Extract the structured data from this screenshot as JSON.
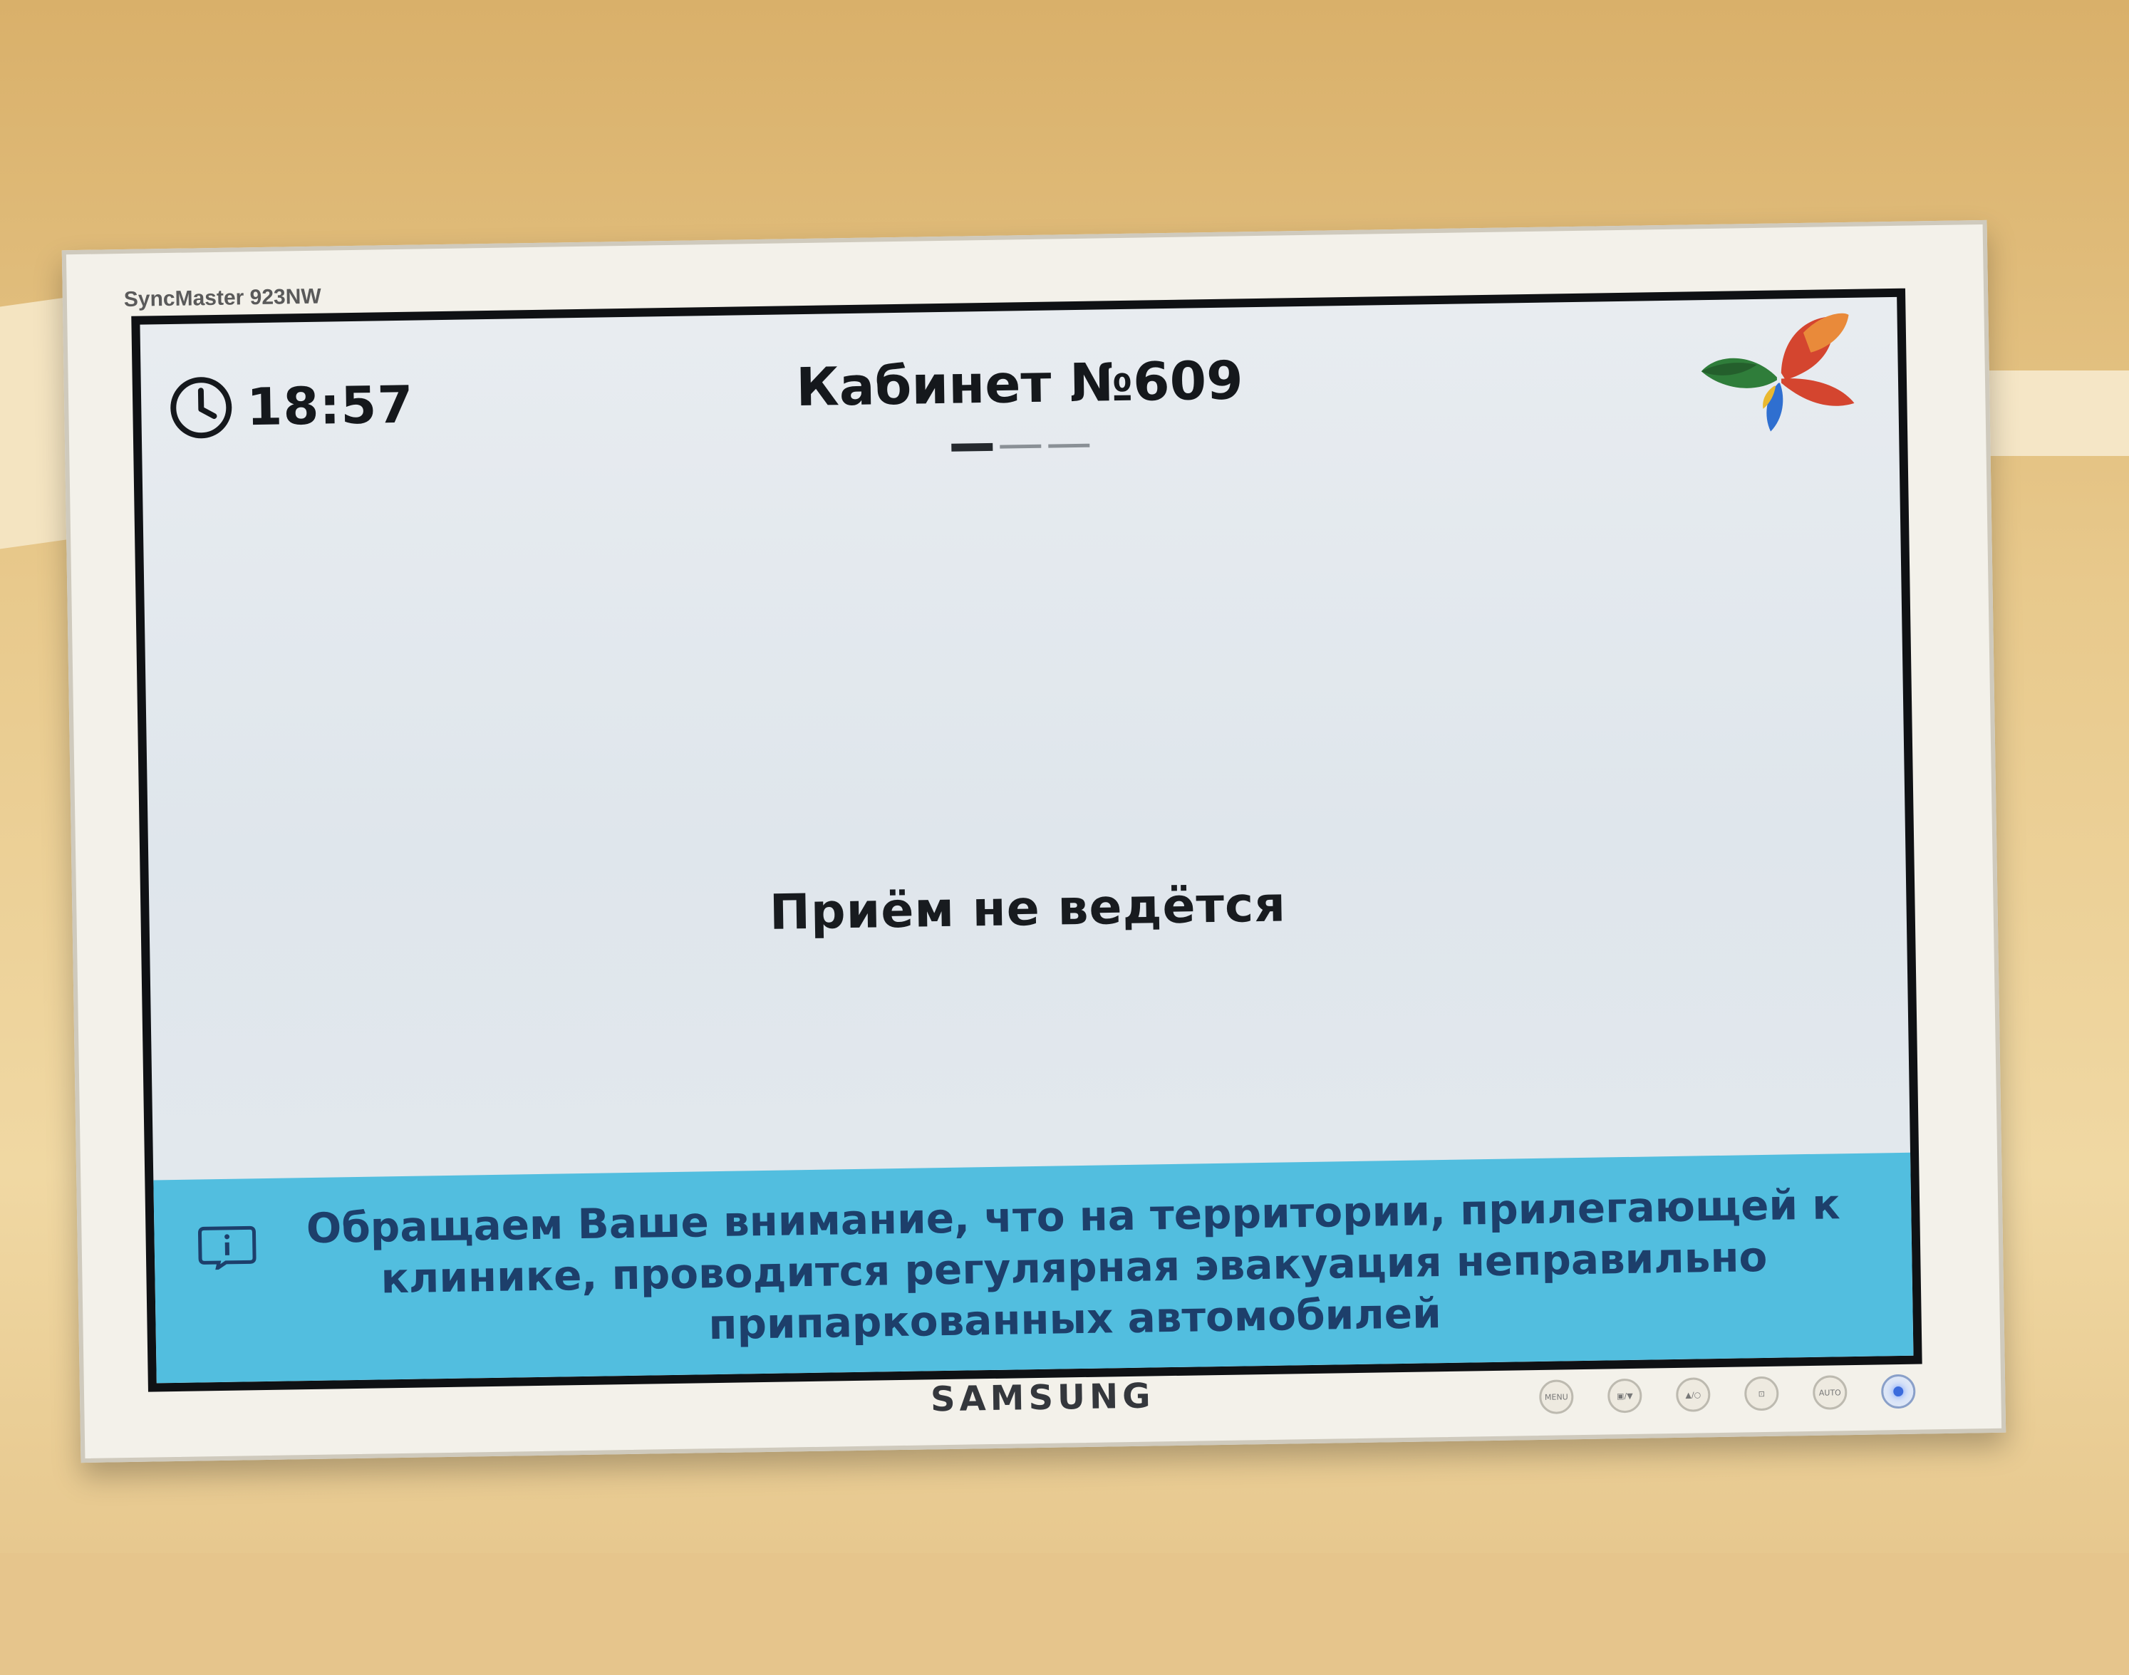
{
  "monitor": {
    "model_label": "SyncMaster 923NW",
    "brand": "SAMSUNG",
    "buttons": [
      "MENU",
      "▣/▼",
      "▲/○",
      "⊡",
      "AUTO",
      ""
    ]
  },
  "header": {
    "time": "18:57",
    "room_title": "Кабинет №609",
    "pager": {
      "pages": 3,
      "active_index": 0
    }
  },
  "main": {
    "status_text": "Приём не ведётся"
  },
  "notice": {
    "text": "Обращаем Ваше внимание, что на территории, прилегающей к клинике, проводится регулярная эвакуация неправильно припаркованных автомобилей",
    "icon": "info-icon"
  },
  "colors": {
    "screen_background": "#e4e9ee",
    "notice_background": "#52bedf",
    "notice_text": "#1d3f6b",
    "logo_red": "#d4452f",
    "logo_orange": "#e98a3a",
    "logo_green": "#2f7d3a",
    "logo_blue": "#2f6fd0"
  }
}
